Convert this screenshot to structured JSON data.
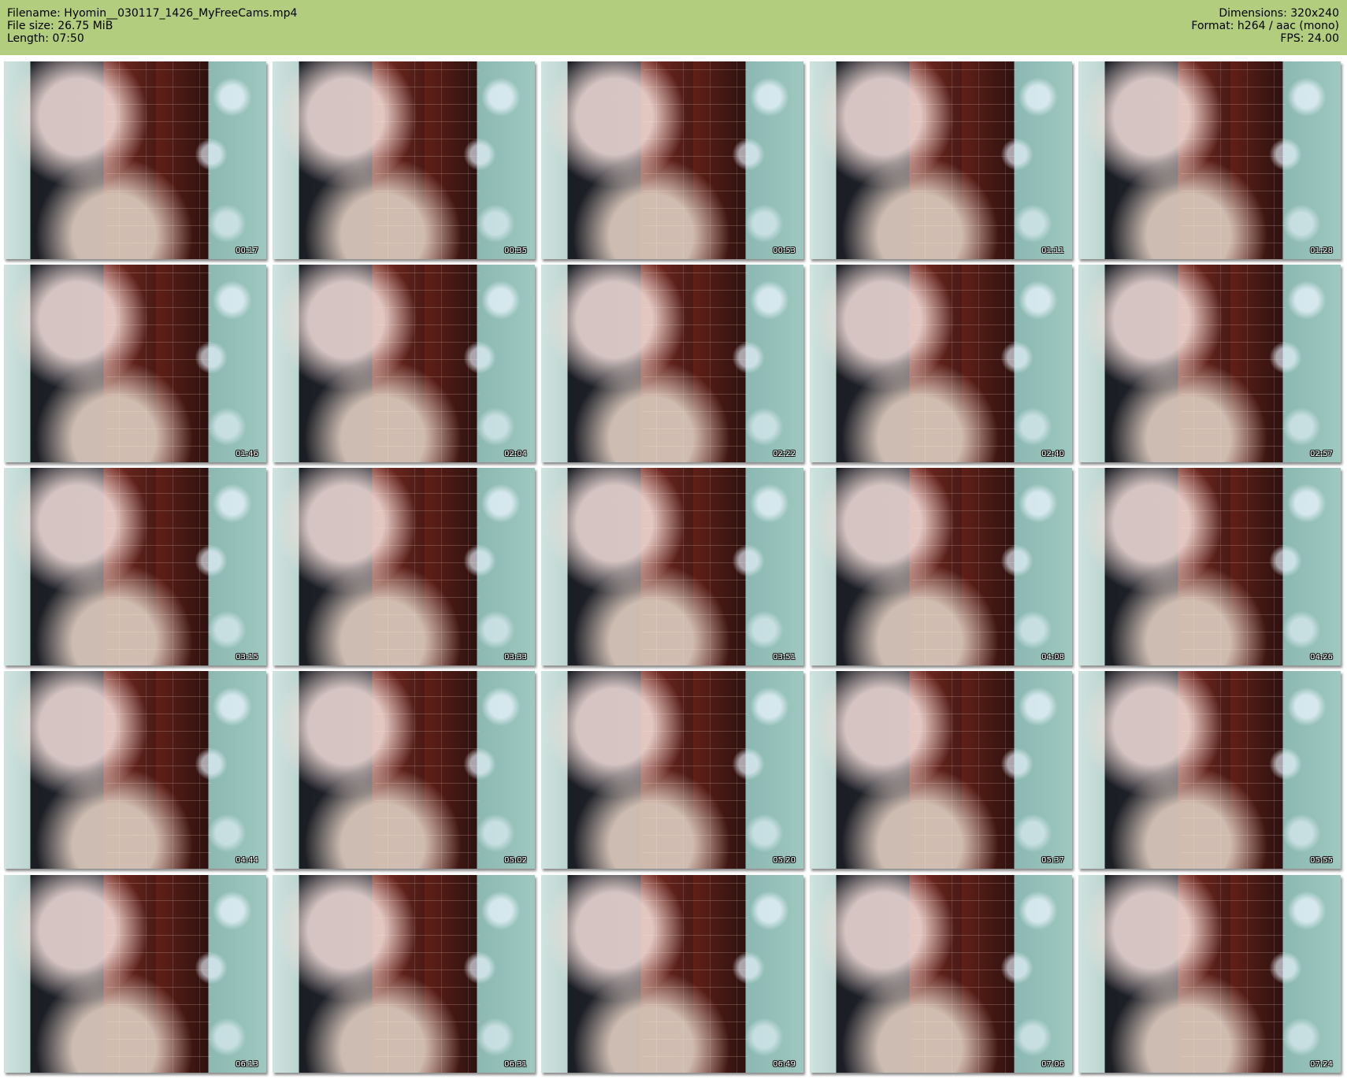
{
  "header": {
    "filename": "Filename: Hyomin__030117_1426_MyFreeCams.mp4",
    "filesize": "File size: 26.75 MiB",
    "length": "Length: 07:50",
    "dimensions": "Dimensions: 320x240",
    "format": "Format: h264 / aac (mono)",
    "fps": "FPS: 24.00"
  },
  "thumbnails": [
    {
      "timestamp": "00:17"
    },
    {
      "timestamp": "00:35"
    },
    {
      "timestamp": "00:53"
    },
    {
      "timestamp": "01:11"
    },
    {
      "timestamp": "01:28"
    },
    {
      "timestamp": "01:46"
    },
    {
      "timestamp": "02:04"
    },
    {
      "timestamp": "02:22"
    },
    {
      "timestamp": "02:40"
    },
    {
      "timestamp": "02:57"
    },
    {
      "timestamp": "03:15"
    },
    {
      "timestamp": "03:33"
    },
    {
      "timestamp": "03:51"
    },
    {
      "timestamp": "04:08"
    },
    {
      "timestamp": "04:26"
    },
    {
      "timestamp": "04:44"
    },
    {
      "timestamp": "05:02"
    },
    {
      "timestamp": "05:20"
    },
    {
      "timestamp": "05:37"
    },
    {
      "timestamp": "05:55"
    },
    {
      "timestamp": "06:13"
    },
    {
      "timestamp": "06:31"
    },
    {
      "timestamp": "06:49"
    },
    {
      "timestamp": "07:06"
    },
    {
      "timestamp": "07:24"
    }
  ]
}
